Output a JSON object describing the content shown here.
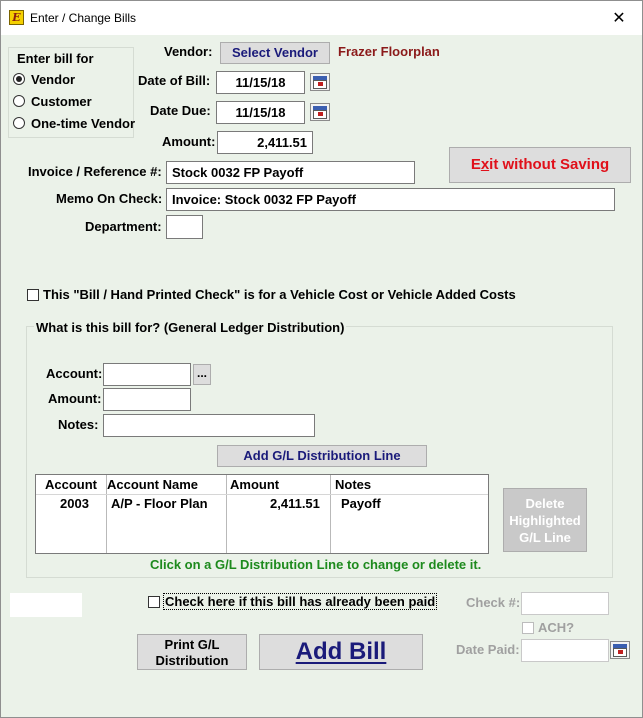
{
  "window": {
    "app_icon_letter": "E",
    "title": "Enter / Change Bills",
    "close_glyph": "✕"
  },
  "bill_for": {
    "legend": "Enter bill for",
    "options": [
      {
        "label": "Vendor",
        "selected": true
      },
      {
        "label": "Customer",
        "selected": false
      },
      {
        "label": "One-time Vendor",
        "selected": false
      }
    ]
  },
  "vendor": {
    "label": "Vendor:",
    "button": "Select Vendor",
    "name": "Frazer Floorplan",
    "name_color": "#8b1a1a"
  },
  "date_of_bill": {
    "label": "Date of Bill:",
    "value": "11/15/18",
    "icon": "calendar-icon"
  },
  "date_due": {
    "label": "Date Due:",
    "value": "11/15/18",
    "icon": "calendar-icon"
  },
  "amount": {
    "label": "Amount:",
    "value": "2,411.51"
  },
  "invoice": {
    "label": "Invoice / Reference #:",
    "value": "Stock 0032 FP Payoff"
  },
  "memo": {
    "label": "Memo On Check:",
    "value": "Invoice: Stock 0032 FP Payoff"
  },
  "department": {
    "label": "Department:",
    "value": ""
  },
  "exit_button": {
    "label_prefix": "E",
    "label_underlined": "x",
    "label_suffix": "it without Saving",
    "color": "#e0101a"
  },
  "vehicle_cost": {
    "label": "This \"Bill / Hand Printed Check\" is for a Vehicle Cost or Vehicle Added Costs",
    "checked": false
  },
  "gl": {
    "legend": "What is this bill for? (General Ledger Distribution)",
    "account_label": "Account:",
    "account_value": "",
    "browse_button": "...",
    "amount_label": "Amount:",
    "amount_value": "",
    "notes_label": "Notes:",
    "notes_value": "",
    "add_button": "Add G/L Distribution Line",
    "columns": [
      "Account",
      "Account Name",
      "Amount",
      "Notes"
    ],
    "rows": [
      {
        "account": "2003",
        "account_name": "A/P - Floor Plan",
        "amount": "2,411.51",
        "notes": "Payoff"
      }
    ],
    "delete_button": [
      "Delete",
      "Highlighted",
      "G/L Line"
    ],
    "hint": "Click on a G/L Distribution Line to change or delete it.",
    "hint_color": "#1d8a1d"
  },
  "already_paid": {
    "label": "Check here if this bill has already been paid",
    "checked": false
  },
  "check_number": {
    "label": "Check #:",
    "value": ""
  },
  "ach": {
    "label": "ACH?",
    "checked": false
  },
  "date_paid": {
    "label": "Date Paid:",
    "value": "",
    "icon": "calendar-icon"
  },
  "print_button": [
    "Print G/L",
    "Distribution"
  ],
  "add_bill_button": "Add Bill",
  "accent_blue": "#1a1a7a"
}
